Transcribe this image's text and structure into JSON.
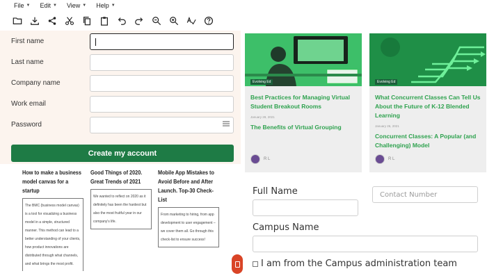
{
  "menubar": [
    "File",
    "Edit",
    "View",
    "Help"
  ],
  "toolbar_icons": [
    "folder-icon",
    "download-icon",
    "share-icon",
    "cut-icon",
    "copy-icon",
    "paste-icon",
    "undo-icon",
    "redo-icon",
    "zoom-out-icon",
    "zoom-in-icon",
    "spellcheck-icon",
    "help-icon"
  ],
  "signup": {
    "first_name": "First name",
    "last_name": "Last name",
    "company_name": "Company name",
    "work_email": "Work email",
    "password": "Password",
    "submit": "Create my account"
  },
  "cards": [
    {
      "tag": "Evolving Ed",
      "title1": "Best Practices for Managing Virtual Student Breakout Rooms",
      "date": "January 28, 2021",
      "title2": "The Benefits of Virtual Grouping",
      "author": "R L"
    },
    {
      "tag": "Evolving Ed",
      "title1": "What Concurrent Classes Can Tell Us About the Future of K-12 Blended Learning",
      "date": "January 26, 2021",
      "title2": "Concurrent Classes: A Popular (and Challenging) Model",
      "author": "R L"
    }
  ],
  "articles": [
    {
      "title": "How to make a business model canvas for a startup",
      "body": "The BMC (business model canvas) is a tool for visualizing a business model in a simple, structured manner. This method can lead to a better understanding of your clients, how product innovations are distributed through what channels, and what brings the most profit."
    },
    {
      "title": "Good Things of 2020. Great Trends of 2021",
      "body": "We wanted to reflect on 2020 as it definitely has been the hardest but also the most fruitful year in our company's life."
    },
    {
      "title": "Mobile App Mistakes to Avoid Before and After Launch. Top-30 Check-List",
      "body": "From marketing to hiring, from app development to user engagement – we cover them all. Go through this check-list to ensure success!"
    }
  ],
  "campus": {
    "full_name": "Full Name",
    "contact_placeholder": "Contact Number",
    "campus_name": "Campus Name",
    "admin_check": "I am from the Campus administration team"
  },
  "colors": {
    "primary_green": "#1e7b45",
    "link_green": "#2fa24f",
    "fab_orange": "#d94426",
    "form_bg": "#fcf4ee"
  }
}
